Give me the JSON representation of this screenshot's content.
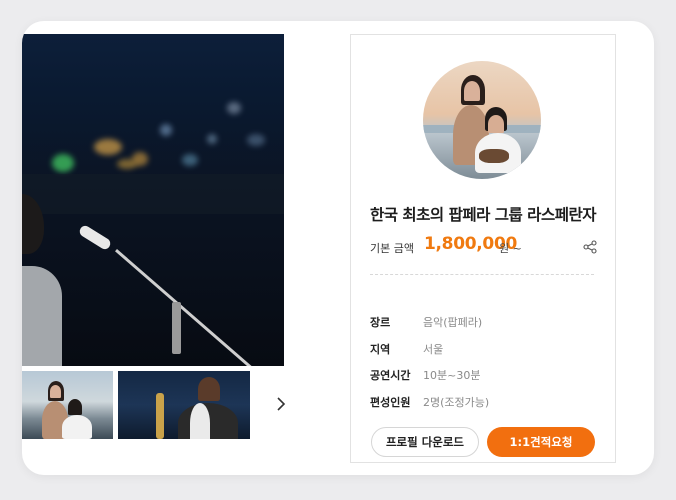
{
  "product": {
    "title": "한국 최초의 팝페라 그룹 라스페란자",
    "price_label": "기본 금액",
    "price": "1,800,000",
    "price_unit": "원 ~",
    "details": [
      {
        "label": "장르",
        "value": "음악(팝페라)"
      },
      {
        "label": "지역",
        "value": "서울"
      },
      {
        "label": "공연시간",
        "value": "10분~30분"
      },
      {
        "label": "편성인원",
        "value": "2명(조정가능)"
      }
    ]
  },
  "buttons": {
    "download": "프로필 다운로드",
    "quote": "1:1견적요청"
  },
  "colors": {
    "accent": "#f26f0f",
    "price": "#f07a10"
  },
  "icons": {
    "share": "share-icon",
    "next": "chevron-right-icon"
  }
}
